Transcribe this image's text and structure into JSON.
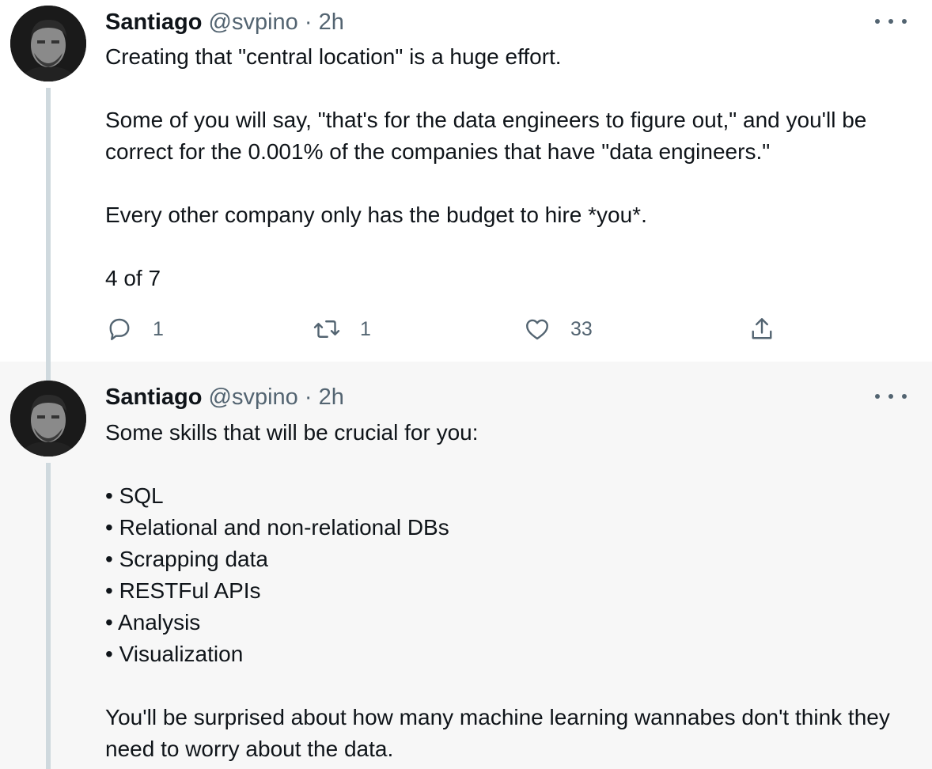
{
  "tweets": [
    {
      "author_name": "Santiago",
      "author_handle": "@svpino",
      "separator": "·",
      "time": "2h",
      "text_paragraphs": [
        "Creating that \"central location\" is a huge effort.",
        "Some of you will say, \"that's for the data engineers to figure out,\" and you'll be correct for the 0.001% of the companies that have \"data engineers.\"",
        "Every other company only has the budget to hire *you*.",
        "4 of 7"
      ],
      "actions": {
        "reply_count": "1",
        "retweet_count": "1",
        "like_count": "33"
      }
    },
    {
      "author_name": "Santiago",
      "author_handle": "@svpino",
      "separator": "·",
      "time": "2h",
      "text_paragraphs": [
        "Some skills that will be crucial for you:",
        "• SQL\n• Relational and non-relational DBs\n• Scrapping data\n• RESTFul APIs\n• Analysis\n• Visualization",
        "You'll be surprised about how many machine learning wannabes don't think they need to worry about the data."
      ]
    }
  ],
  "icons": {
    "reply": "reply-icon",
    "retweet": "retweet-icon",
    "like": "heart-icon",
    "share": "share-icon",
    "more": "more-options-icon"
  },
  "colors": {
    "text": "#0f1419",
    "secondary": "#536471",
    "thread_line": "#cfd9de",
    "highlight_bg": "#f7f7f7"
  }
}
